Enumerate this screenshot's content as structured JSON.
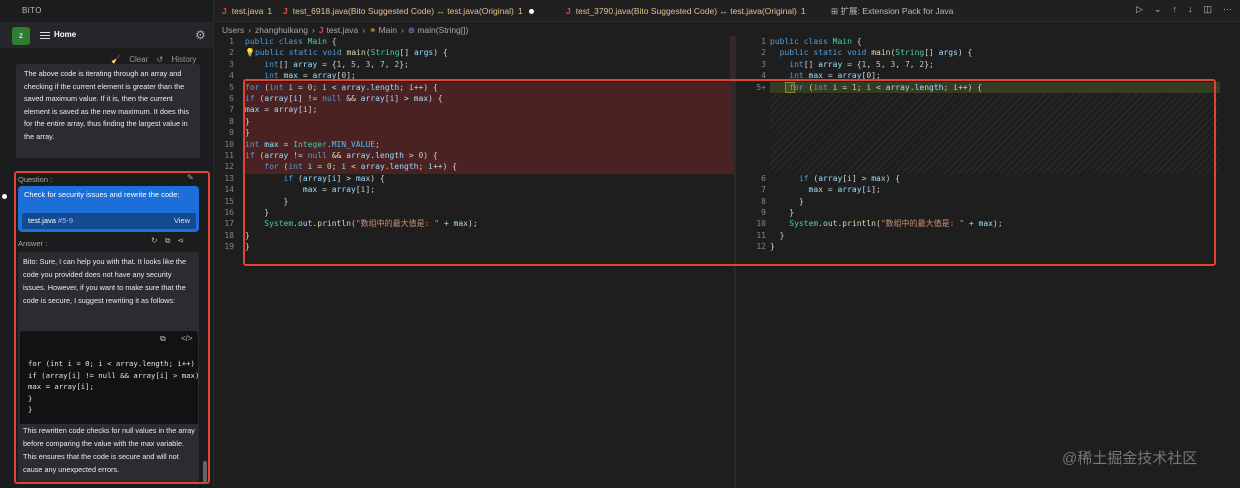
{
  "panel": {
    "title": "BITO",
    "avatar_letter": "z",
    "home_label": "Home",
    "clear_label": "Clear",
    "history_label": "History",
    "previous_answer": "The above code is iterating through an array and checking if the current element is greater than the saved maximum value. If it is, then the current element is saved as the new maximum. It does this for the entire array, thus finding the largest value in the array.",
    "question_label": "Question :",
    "question_text": "Check for security issues and rewrite the code:",
    "file_name": "test.java",
    "file_lines": "#5-9",
    "view_label": "View",
    "answer_label": "Answer :",
    "answer_intro": "Bito: Sure, I can help you with that. It looks like the code you provided does not have any security issues. However, if you want to make sure that the code is secure, I suggest rewriting it as follows:",
    "code_lines": [
      "for (int i = 0; i < array.length; i++) {",
      "if (array[i] != null && array[i] > max) {",
      "max = array[i];",
      "}",
      "}"
    ],
    "answer_outro": "This rewritten code checks for null values in the array before comparing the value with the max variable. This ensures that the code is secure and will not cause any unexpected errors."
  },
  "tabs": [
    {
      "label": "test.java",
      "count": "1"
    },
    {
      "label": "test_6918.java(Bito Suggested Code) ↔ test.java(Original)",
      "count": "1"
    },
    {
      "label": "test_3790.java(Bito Suggested Code) ↔ test.java(Original)",
      "count": "1"
    },
    {
      "label": "扩展: Extension Pack for Java"
    }
  ],
  "breadcrumb": {
    "users": "Users",
    "user": "zhanghuikang",
    "file": "test.java",
    "class": "Main",
    "method": "main(String[])"
  },
  "left_editor": {
    "lines": [
      {
        "n": "1",
        "t": "public class Main {"
      },
      {
        "n": "2",
        "t": "💡public static void main(String[] args) {"
      },
      {
        "n": "3",
        "t": "    int[] array = {1, 5, 3, 7, 2};"
      },
      {
        "n": "4",
        "t": "    int max = array[0];"
      },
      {
        "n": "5",
        "t": "for (int i = 0; i < array.length; i++) {"
      },
      {
        "n": "6",
        "t": "if (array[i] != null && array[i] > max) {"
      },
      {
        "n": "7",
        "t": "max = array[i];"
      },
      {
        "n": "8",
        "t": "}"
      },
      {
        "n": "9",
        "t": "}"
      },
      {
        "n": "10",
        "t": "int max = Integer.MIN_VALUE;"
      },
      {
        "n": "11",
        "t": "if (array != null && array.length > 0) {"
      },
      {
        "n": "12",
        "t": "    for (int i = 0; i < array.length; i++) {"
      },
      {
        "n": "13",
        "t": "        if (array[i] > max) {"
      },
      {
        "n": "14",
        "t": "            max = array[i];"
      },
      {
        "n": "15",
        "t": "        }"
      },
      {
        "n": "16",
        "t": "    }"
      },
      {
        "n": "17",
        "t": "    System.out.println(\"数组中的最大值是: \" + max);"
      },
      {
        "n": "18",
        "t": "}"
      },
      {
        "n": "19",
        "t": "}"
      }
    ]
  },
  "right_editor": {
    "lines": [
      {
        "n": "1",
        "t": "public class Main {"
      },
      {
        "n": "2",
        "t": "  public static void main(String[] args) {"
      },
      {
        "n": "3",
        "t": "    int[] array = {1, 5, 3, 7, 2};"
      },
      {
        "n": "4",
        "t": "    int max = array[0];"
      },
      {
        "n": "5+",
        "t": "    for (int i = 1; i < array.length; i++) {"
      },
      {
        "n": "6",
        "t": "      if (array[i] > max) {"
      },
      {
        "n": "7",
        "t": "        max = array[i];"
      },
      {
        "n": "8",
        "t": "      }"
      },
      {
        "n": "9",
        "t": "    }"
      },
      {
        "n": "10",
        "t": "    System.out.println(\"数组中的最大值是: \" + max);"
      },
      {
        "n": "11",
        "t": "  }"
      },
      {
        "n": "12",
        "t": "}"
      }
    ]
  },
  "watermark": "@稀土掘金技术社区",
  "colors": {
    "accent_red": "#e04434",
    "question_blue": "#1c6ed8",
    "removed_bg": "#4a2222",
    "added_bg": "#353c22"
  }
}
